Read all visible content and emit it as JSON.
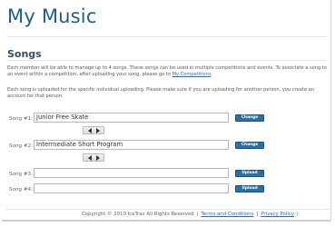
{
  "header": {
    "title": "My Music"
  },
  "section": {
    "title": "Songs"
  },
  "intro": {
    "p1_text": "Each member will be able to manage up to 4 songs. These songs can be used in multiple competitions and events. To associate a song to an event within a competition, after uploading your song, please go to ",
    "p1_link": "My Competitions",
    "p1_end": ".",
    "p2": "Each song is uploaded for the specific individual uploading. Please make sure if you are uploading for another person, you create an account for that person."
  },
  "songs": [
    {
      "label": "Song #1:",
      "value": "Junior Free Skate",
      "button": "Change"
    },
    {
      "label": "Song #2:",
      "value": "Intermediate Short Program",
      "button": "Change"
    },
    {
      "label": "Song #3:",
      "value": "",
      "button": "Upload"
    },
    {
      "label": "Song #4:",
      "value": "",
      "button": "Upload"
    }
  ],
  "footer": {
    "copyright": "Copyright © 2010 IceTrax All Rights Reserved",
    "terms": "Terms and Conditions",
    "privacy": "Privacy Policy",
    "separator": "|"
  },
  "colors": {
    "title": "#1d5f8a",
    "button": "#2c6ea6",
    "link": "#2a6db1"
  }
}
